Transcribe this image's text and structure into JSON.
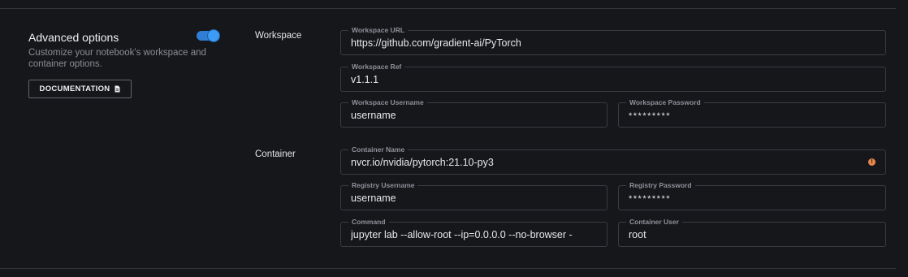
{
  "advanced": {
    "title": "Advanced options",
    "description": "Customize your notebook's workspace and container options.",
    "toggle_on": true,
    "doc_button": "DOCUMENTATION",
    "doc_icon": "file-icon"
  },
  "workspace": {
    "section_label": "Workspace",
    "url": {
      "label": "Workspace URL",
      "value": "https://github.com/gradient-ai/PyTorch"
    },
    "ref": {
      "label": "Workspace Ref",
      "value": "v1.1.1"
    },
    "username": {
      "label": "Workspace Username",
      "value": "username"
    },
    "password": {
      "label": "Workspace Password",
      "value": "*********"
    }
  },
  "container": {
    "section_label": "Container",
    "name": {
      "label": "Container Name",
      "value": "nvcr.io/nvidia/pytorch:21.10-py3",
      "status_icon": "warning-icon"
    },
    "registry_username": {
      "label": "Registry Username",
      "value": "username"
    },
    "registry_password": {
      "label": "Registry Password",
      "value": "*********"
    },
    "command": {
      "label": "Command",
      "value": "jupyter lab --allow-root --ip=0.0.0.0 --no-browser -"
    },
    "user": {
      "label": "Container User",
      "value": "root"
    }
  },
  "colors": {
    "background": "#16171b",
    "accent": "#3b9bf5",
    "warning": "#e8874a"
  }
}
